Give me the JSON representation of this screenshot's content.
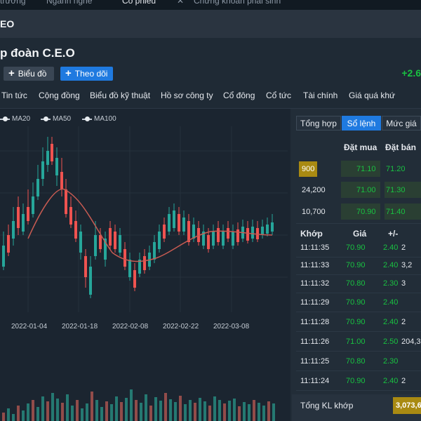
{
  "top_tabs": [
    "trường",
    "Ngành nghề",
    "Cổ phiếu",
    "Chứng khoán phái sinh"
  ],
  "symbol": "EO",
  "company_name": "p đoàn C.E.O",
  "buttons": {
    "chart": "Biểu đồ",
    "follow": "Theo dõi"
  },
  "price_change": "+2.6",
  "nav_tabs": [
    "Tin tức",
    "Cộng đồng",
    "Biểu đồ kỹ thuật",
    "Hồ sơ công ty",
    "Cổ đông",
    "Cổ tức",
    "Tài chính",
    "Giá quá khứ"
  ],
  "legend": [
    "MA20",
    "MA50",
    "MA100"
  ],
  "x_labels": [
    "2022-01-04",
    "2022-01-18",
    "2022-02-08",
    "2022-02-22",
    "2022-03-08"
  ],
  "panel_tabs": [
    "Tổng hợp",
    "Sổ lệnh",
    "Mức giá"
  ],
  "orderbook": {
    "headers": {
      "bid": "Đặt mua",
      "ask": "Đặt bán"
    },
    "rows": [
      {
        "qty": "900",
        "bid": "71.10",
        "ask": "71.20"
      },
      {
        "qty": "24,200",
        "bid": "71.00",
        "ask": "71.30"
      },
      {
        "qty": "10,700",
        "bid": "70.90",
        "ask": "71.40"
      }
    ]
  },
  "trades": {
    "headers": {
      "time": "Khớp",
      "price": "Giá",
      "change": "+/-"
    },
    "rows": [
      {
        "time": "11:11:35",
        "price": "70.90",
        "change": "2.40",
        "vol": "2"
      },
      {
        "time": "11:11:33",
        "price": "70.90",
        "change": "2.40",
        "vol": "3,2"
      },
      {
        "time": "11:11:32",
        "price": "70.80",
        "change": "2.30",
        "vol": "3"
      },
      {
        "time": "11:11:29",
        "price": "70.90",
        "change": "2.40",
        "vol": ""
      },
      {
        "time": "11:11:28",
        "price": "70.90",
        "change": "2.40",
        "vol": "2"
      },
      {
        "time": "11:11:26",
        "price": "71.00",
        "change": "2.50",
        "vol": "204,3"
      },
      {
        "time": "11:11:25",
        "price": "70.80",
        "change": "2.30",
        "vol": ""
      },
      {
        "time": "11:11:24",
        "price": "70.90",
        "change": "2.40",
        "vol": "2"
      }
    ]
  },
  "total": {
    "label": "Tổng KL khớp",
    "value": "3,073,6"
  },
  "colors": {
    "up": "#26a69a",
    "down": "#ef5350",
    "accent": "#1f7ae0",
    "green": "#19c141",
    "highlight": "#a98a12"
  }
}
